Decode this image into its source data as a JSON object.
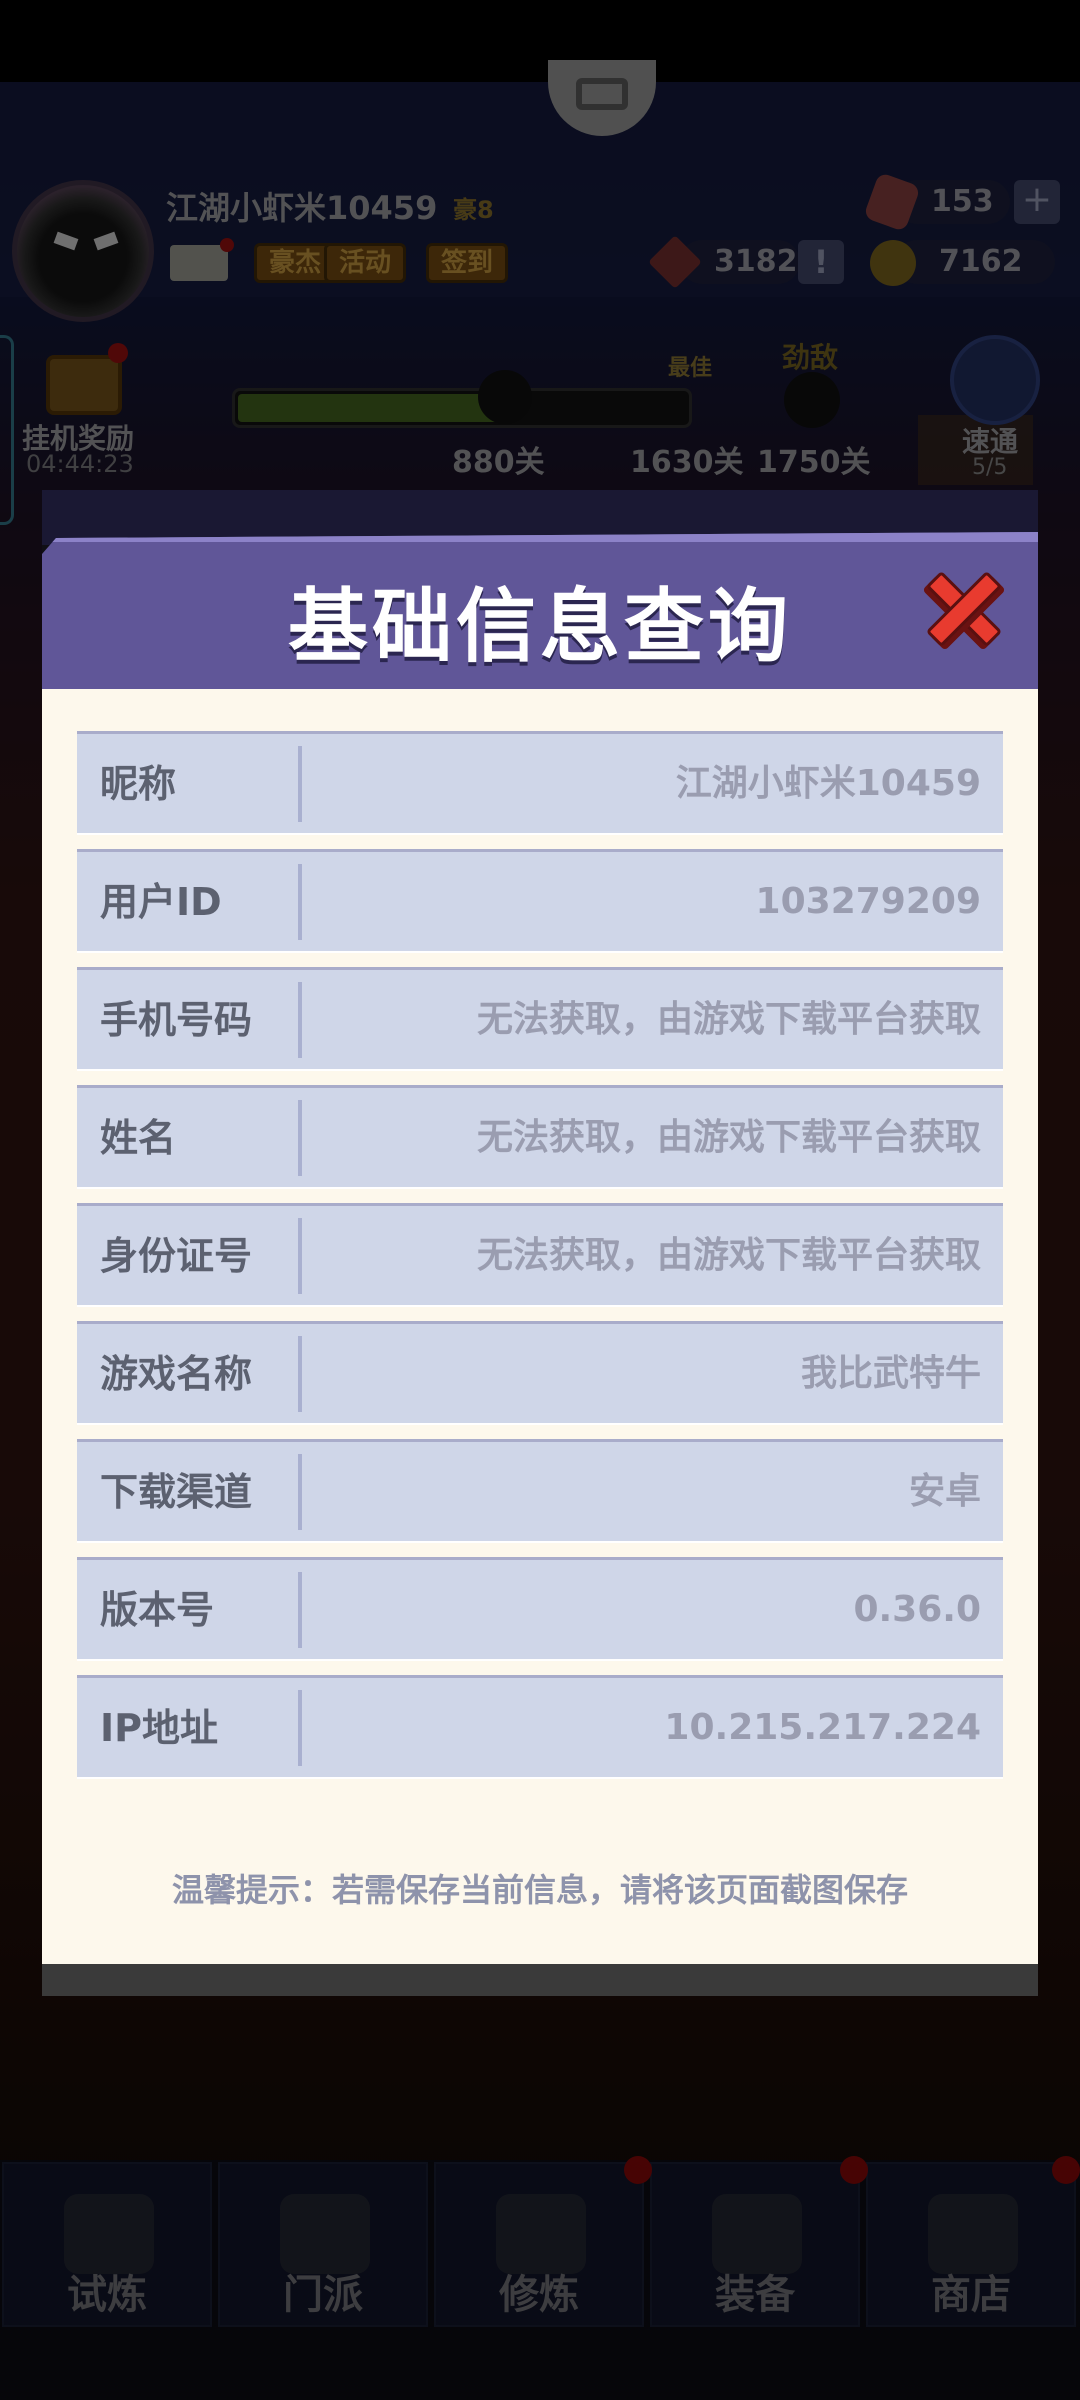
{
  "player": {
    "name": "江湖小虾米10459",
    "vip": "豪8",
    "mail_label": "",
    "buttons": [
      "豪杰",
      "活动",
      "签到"
    ]
  },
  "resources": {
    "gems": "153",
    "tickets": "3182",
    "coins": "7162"
  },
  "idle_reward": {
    "label": "挂机奖励",
    "timer": "04:44:23"
  },
  "progress": {
    "current_stage": "880关",
    "best_label": "最佳",
    "best_stage": "1630关",
    "rival_label": "劲敌",
    "rival_stage": "1750关",
    "fill_fraction": 0.62
  },
  "speed": {
    "label": "速通",
    "count": "5/5"
  },
  "dialog": {
    "title": "基础信息查询",
    "rows": [
      {
        "label": "昵称",
        "value": "江湖小虾米10459"
      },
      {
        "label": "用户ID",
        "value": "103279209"
      },
      {
        "label": "手机号码",
        "value": "无法获取，由游戏下载平台获取"
      },
      {
        "label": "姓名",
        "value": "无法获取，由游戏下载平台获取"
      },
      {
        "label": "身份证号",
        "value": "无法获取，由游戏下载平台获取"
      },
      {
        "label": "游戏名称",
        "value": "我比武特牛"
      },
      {
        "label": "下载渠道",
        "value": "安卓"
      },
      {
        "label": "版本号",
        "value": "0.36.0"
      },
      {
        "label": "IP地址",
        "value": "10.215.217.224"
      }
    ],
    "tip": "温馨提示：若需保存当前信息，请将该页面截图保存"
  },
  "tabs": [
    {
      "label": "试炼",
      "icon": "ninja-icon"
    },
    {
      "label": "门派",
      "icon": "temple-icon"
    },
    {
      "label": "修炼",
      "icon": "scroll-book-icon"
    },
    {
      "label": "装备",
      "icon": "swords-icon"
    },
    {
      "label": "商店",
      "icon": "shop-icon"
    }
  ],
  "colors": {
    "header": "#605698",
    "body": "#fdf8ec",
    "row": "#cfd6e8",
    "close": "#e83b2f"
  }
}
